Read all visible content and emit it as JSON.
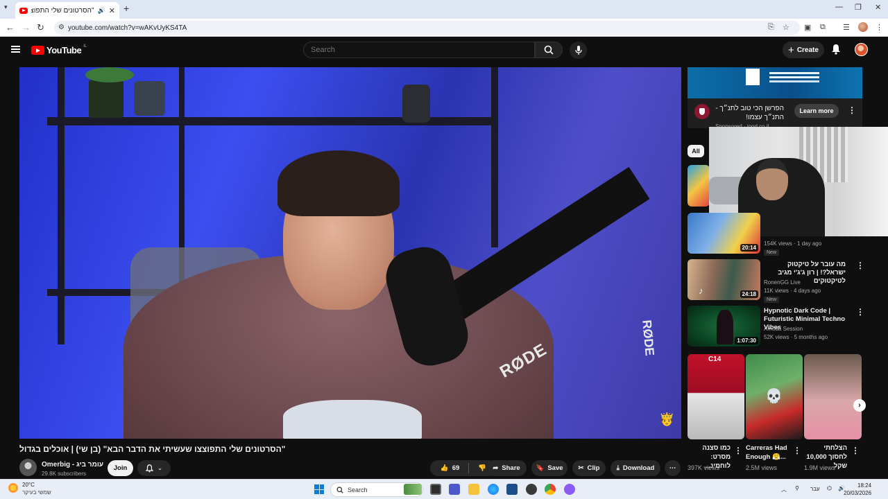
{
  "browser": {
    "tab_title": "\"הסרטונים שלי התפוצצו ש",
    "close_glyph": "✕",
    "new_tab_glyph": "+",
    "url": "youtube.com/watch?v=wAKvUyKS4TA"
  },
  "youtube": {
    "logo_text": "YouTube",
    "country_code": "IL",
    "search_placeholder": "Search",
    "create_label": "Create"
  },
  "video": {
    "title": "\"הסרטונים שלי התפוצצו שעשיתי את הדבר הבא\" (בן שי) | אוכלים בגדול",
    "channel_name": "Omerbig - עומר ביג",
    "subscribers": "29.8K subscribers",
    "join_label": "Join",
    "likes": "69",
    "share_label": "Share",
    "save_label": "Save",
    "clip_label": "Clip",
    "download_label": "Download",
    "overlay_mic_brand": "RØDE"
  },
  "ad": {
    "title": "הפרשן הכי טוב לתנ״ך - התנ״ך עצמו!",
    "sponsored": "Sponsored · ipod.co.il",
    "learn_more": "Learn more"
  },
  "filter_chip": "All",
  "recommended": [
    {
      "title": "",
      "meta": "154K views · 1 day ago",
      "badge": "New",
      "duration": "20:14"
    },
    {
      "title": "מה עובר על טיקטוק ישראל?! | רון ג'ג'י מגיב לטיקטוקים",
      "channel": "RonenGG Live",
      "meta": "11K views · 4 days ago",
      "badge": "New",
      "duration": "24:18"
    },
    {
      "title": "Hypnotic Dark Code | Futuristic Minimal Techno Vibes",
      "channel": "Amoda Session",
      "meta": "52K views · 5 months ago",
      "duration": "1:07:30"
    }
  ],
  "shorts": [
    {
      "title": "כמו סצנה מסרט: לוחמינ...",
      "views": "397K views",
      "tag": "C14"
    },
    {
      "title": "Carreras Had Enough 😤...",
      "views": "2.5M views"
    },
    {
      "title": "הצלחתי לחסוך 10,000 שקל",
      "views": "1.9M views"
    }
  ],
  "taskbar": {
    "temperature": "20°C",
    "weather_desc": "שמשי בעיקר",
    "search_label": "Search",
    "lang": "עבר",
    "time": "18:24",
    "date": "20/03/2026"
  }
}
